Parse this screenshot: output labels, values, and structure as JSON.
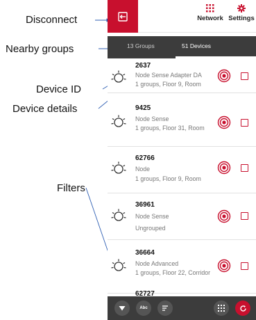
{
  "annotations": {
    "disconnect": "Disconnect",
    "nearby_groups": "Nearby groups",
    "device_id": "Device ID",
    "device_details": "Device details",
    "filters": "Filters"
  },
  "topbar": {
    "network_label": "Network",
    "settings_label": "Settings"
  },
  "tabs": {
    "groups_label": "13 Groups",
    "devices_label": "51 Devices"
  },
  "devices": [
    {
      "id": "2637",
      "type": "Node Sense Adapter DA",
      "group": "1 groups, Floor 9, Room"
    },
    {
      "id": "9425",
      "type": "Node Sense",
      "group": "1 groups, Floor 31, Room"
    },
    {
      "id": "62766",
      "type": "Node",
      "group": "1 groups, Floor 9, Room"
    },
    {
      "id": "36961",
      "type": "Node Sense",
      "group": "Ungrouped"
    },
    {
      "id": "36664",
      "type": "Node Advanced",
      "group": "1 groups, Floor 22, Corridor"
    },
    {
      "id": "62727",
      "type": "",
      "group": ""
    }
  ],
  "bottombar": {
    "name_filter_label": "Abc"
  },
  "colors": {
    "accent": "#c8102e",
    "dark_bar": "#3c3c3c"
  }
}
